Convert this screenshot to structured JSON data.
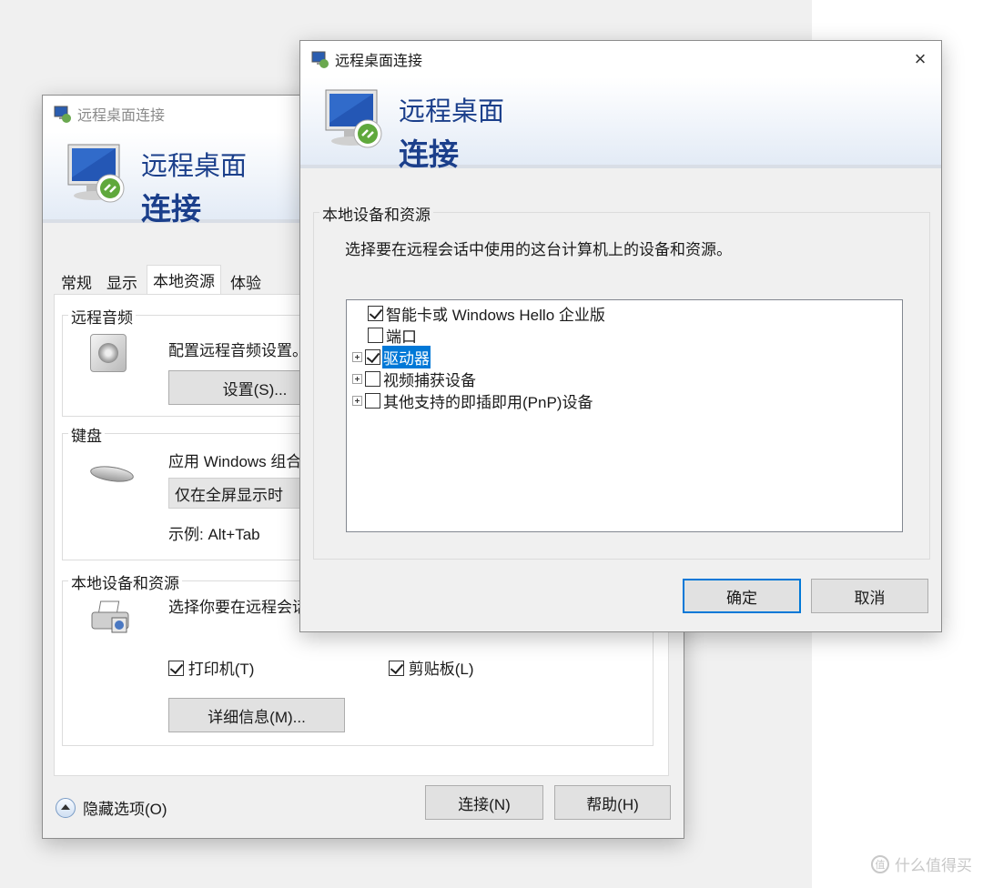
{
  "back_window": {
    "title": "远程桌面连接",
    "banner_line1": "远程桌面",
    "banner_line2": "连接",
    "tabs": [
      "常规",
      "显示",
      "本地资源",
      "体验"
    ],
    "active_tab": "本地资源",
    "audio": {
      "legend": "远程音频",
      "description": "配置远程音频设置。",
      "settings_button": "设置(S)..."
    },
    "keyboard": {
      "legend": "键盘",
      "description": "应用 Windows 组合",
      "dropdown_value": "仅在全屏显示时",
      "example": "示例: Alt+Tab"
    },
    "devices": {
      "legend": "本地设备和资源",
      "description": "选择你要在远程会话",
      "printer_label": "打印机(T)",
      "printer_checked": true,
      "clipboard_label": "剪贴板(L)",
      "clipboard_checked": true,
      "details_button": "详细信息(M)..."
    },
    "hide_options": "隐藏选项(O)",
    "connect_button": "连接(N)",
    "help_button": "帮助(H)"
  },
  "front_window": {
    "title": "远程桌面连接",
    "close_icon": "×",
    "banner_line1": "远程桌面",
    "banner_line2": "连接",
    "group_legend": "本地设备和资源",
    "instruction": "选择要在远程会话中使用的这台计算机上的设备和资源。",
    "tree_items": [
      {
        "label": "智能卡或 Windows Hello 企业版",
        "checked": true,
        "expandable": false,
        "selected": false
      },
      {
        "label": "端口",
        "checked": false,
        "expandable": false,
        "selected": false
      },
      {
        "label": "驱动器",
        "checked": true,
        "expandable": true,
        "selected": true
      },
      {
        "label": "视频捕获设备",
        "checked": false,
        "expandable": true,
        "selected": false
      },
      {
        "label": "其他支持的即插即用(PnP)设备",
        "checked": false,
        "expandable": true,
        "selected": false
      }
    ],
    "ok_button": "确定",
    "cancel_button": "取消"
  },
  "watermark": {
    "logo": "值",
    "text": "什么值得买"
  },
  "colors": {
    "banner_text": "#1b3f8b",
    "selection": "#0078d7",
    "window_bg": "#f0f0f0"
  }
}
